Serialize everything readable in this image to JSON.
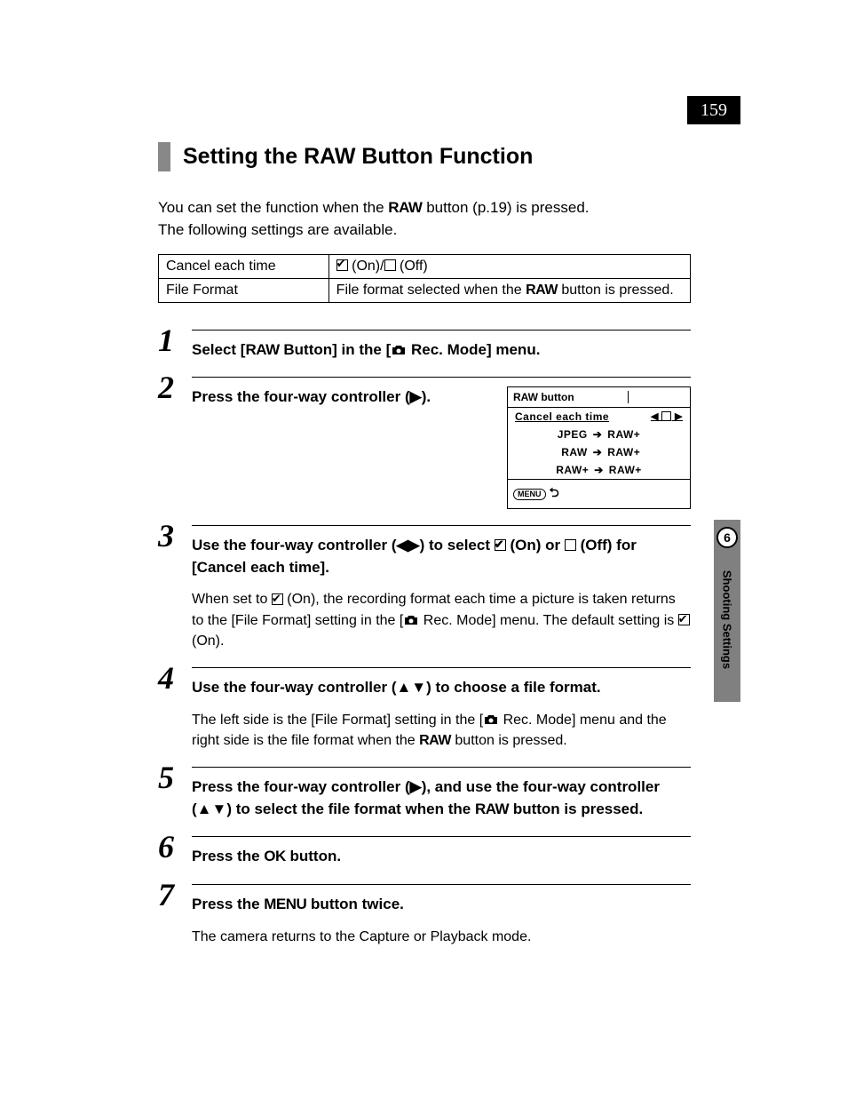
{
  "page_number": "159",
  "side_tab": {
    "number": "6",
    "label": "Shooting Settings"
  },
  "heading": "Setting the RAW Button Function",
  "intro_line1_a": "You can set the function when the ",
  "intro_line1_b": " button (p.19) is pressed.",
  "intro_line2": "The following settings are available.",
  "raw_label": "RAW",
  "table": {
    "r1c1": "Cancel each time",
    "r1c2_on": " (On)/",
    "r1c2_off": " (Off)",
    "r2c1": "File Format",
    "r2c2_a": "File format selected when the ",
    "r2c2_b": " button is pressed."
  },
  "steps": {
    "s1_a": "Select [",
    "s1_b": " Button] in the [",
    "s1_c": " Rec. Mode] menu.",
    "s2_a": "Press the four-way controller (",
    "s2_b": ").",
    "s3_title_a": "Use the four-way controller (",
    "s3_title_b": ") to select ",
    "s3_title_c": " (On) or ",
    "s3_title_d": " (Off) for [Cancel each time].",
    "s3_desc_a": "When set to ",
    "s3_desc_b": " (On), the recording format each time a picture is taken returns to the [File Format] setting in the [",
    "s3_desc_c": " Rec. Mode] menu. The default setting is ",
    "s3_desc_d": " (On).",
    "s4_title_a": "Use the four-way controller (",
    "s4_title_b": ") to choose a file format.",
    "s4_desc_a": "The left side is the [File Format] setting in the [",
    "s4_desc_b": " Rec. Mode] menu and the right side is the file format when the ",
    "s4_desc_c": " button is pressed.",
    "s5_a": "Press the four-way controller (",
    "s5_b": "), and use the four-way controller (",
    "s5_c": ") to select the file format when the ",
    "s5_d": " button is pressed.",
    "s6_a": "Press the ",
    "s6_b": " button.",
    "s7_a": "Press the ",
    "s7_b": " button twice.",
    "s7_desc": "The camera returns to the Capture or Playback mode."
  },
  "step_numbers": [
    "1",
    "2",
    "3",
    "4",
    "5",
    "6",
    "7"
  ],
  "arrows": {
    "right": "▶",
    "left": "◀",
    "up": "▲",
    "down": "▼",
    "leftright": "◀▶",
    "updown": "▲▼"
  },
  "ok_label": "OK",
  "menu_label": "MENU",
  "lcd": {
    "title": "RAW button",
    "row_cancel": "Cancel each time",
    "rows": [
      {
        "left": "JPEG",
        "right": "RAW+"
      },
      {
        "left": "RAW",
        "right": "RAW+"
      },
      {
        "left": "RAW+",
        "right": "RAW+"
      }
    ],
    "menu": "MENU"
  }
}
